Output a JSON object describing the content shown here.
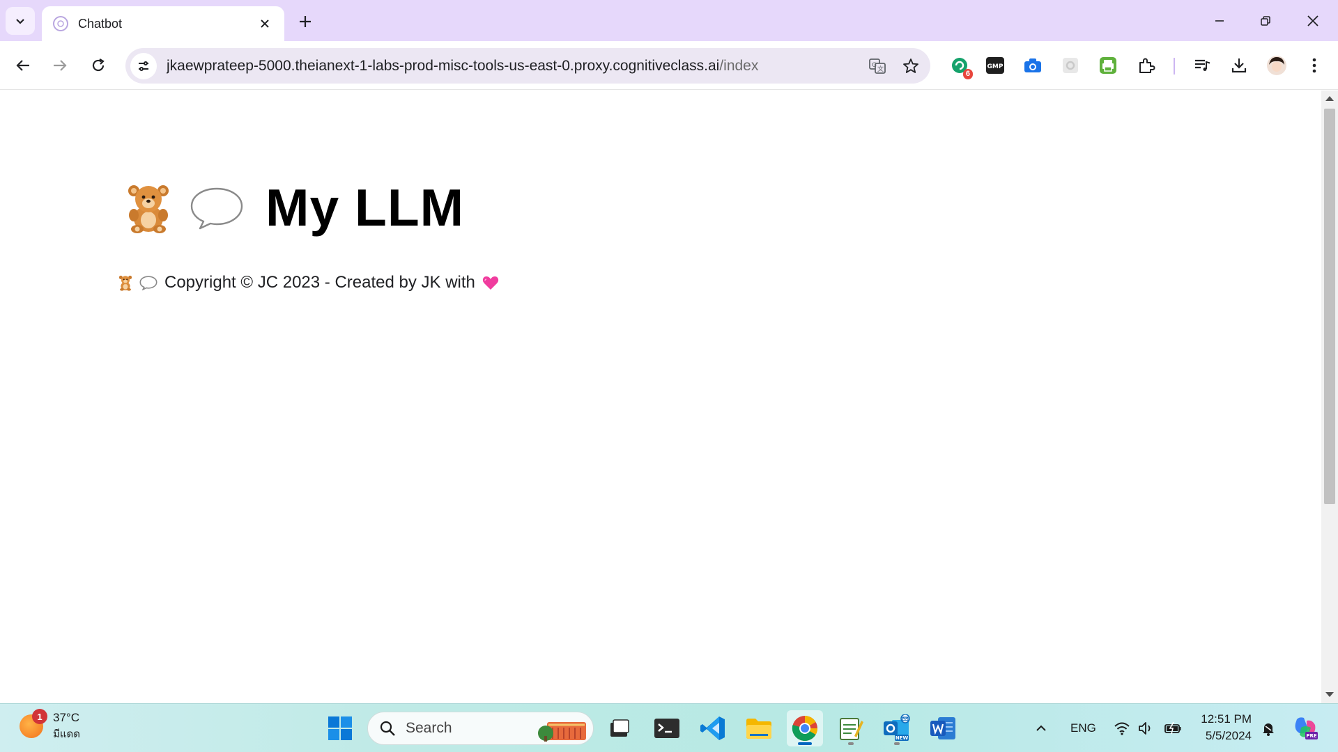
{
  "browser": {
    "tab_title": "Chatbot",
    "url_host": "jkaewprateep-5000.theianext-1-labs-prod-misc-tools-us-east-0.proxy.cognitiveclass.ai",
    "url_path": "/index",
    "extension_badge": "6",
    "gmp_label": "GMP"
  },
  "page": {
    "heading_emoji_bear": "🧸",
    "heading_emoji_bubble": "💬",
    "heading_title": "My LLM",
    "footer_emoji_bear": "🧸",
    "footer_emoji_bubble": "💬",
    "footer_text": "Copyright © JC 2023 - Created by JK with",
    "footer_emoji_heart": "💗"
  },
  "taskbar": {
    "weather_badge": "1",
    "weather_temp": "37°C",
    "weather_desc": "มีแดด",
    "search_label": "Search",
    "language": "ENG",
    "time": "12:51 PM",
    "date": "5/5/2024"
  },
  "colors": {
    "tabstrip": "#e6d8fb",
    "omnibox": "#ece7f3",
    "accent": "#0067c0"
  }
}
